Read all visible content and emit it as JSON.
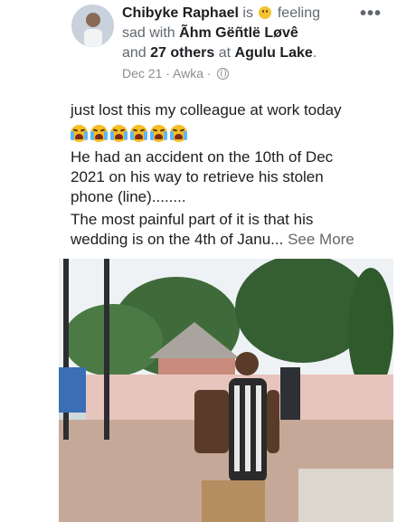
{
  "post": {
    "author": "Chibyke Raphael",
    "status_pre": "is",
    "status_feeling": "feeling",
    "status_line2_pre": "sad with",
    "tagged_person": "Ãhm Gëñtlë Løvê",
    "and": "and",
    "others": "27 others",
    "at": "at",
    "place": "Agulu Lake",
    "period": ".",
    "date": "Dec 21",
    "separator": "·",
    "location": "Awka",
    "separator2": "·",
    "more_label": "•••",
    "text_line1": "just lost this my colleague at work today",
    "text_line3": "He had an accident on the 10th of Dec",
    "text_line4": "2021 on his way to retrieve his stolen",
    "text_line5": "phone (line)........",
    "text_line6": "The most painful part of it is that his",
    "text_line7": "wedding is on the 4th of Janu...",
    "see_more": "See More",
    "emoji_count": 6
  },
  "icons": {
    "avatar": "profile-photo",
    "feeling": "sad-face-emoji",
    "crying": "crying-face-emoji",
    "privacy": "globe-icon",
    "more": "more-options-icon"
  },
  "colors": {
    "text_primary": "#1c1e21",
    "text_secondary": "#606770",
    "meta": "#8a8d91"
  }
}
